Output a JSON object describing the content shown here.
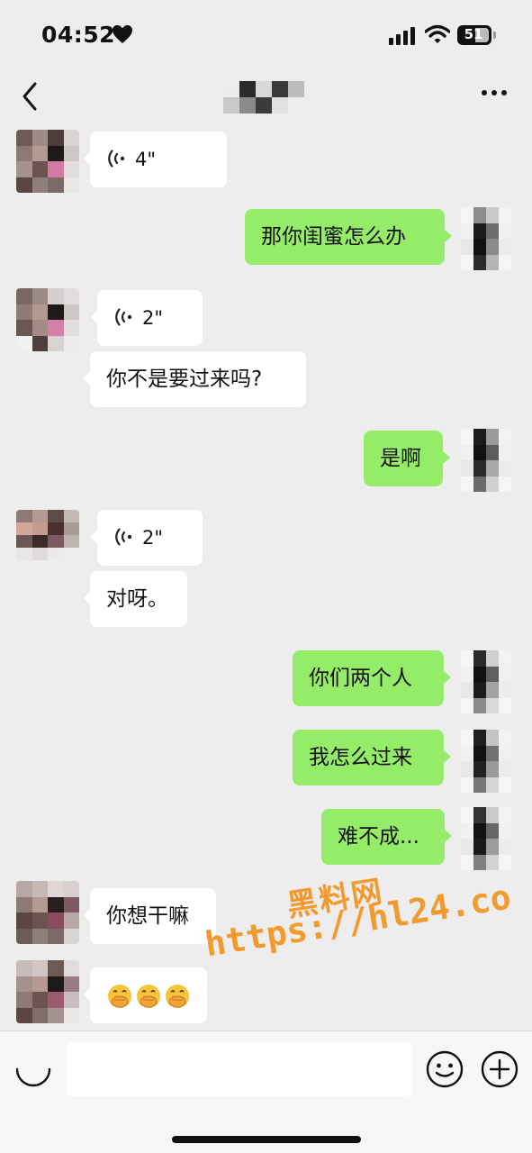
{
  "status": {
    "time": "04:52",
    "battery": "51"
  },
  "messages": [
    {
      "side": "in",
      "kind": "voice",
      "duration": "4\""
    },
    {
      "side": "out",
      "kind": "text",
      "text": "那你闺蜜怎么办"
    },
    {
      "side": "in",
      "kind": "voice",
      "duration": "2\""
    },
    {
      "side": "in",
      "kind": "text",
      "text": "你不是要过来吗?"
    },
    {
      "side": "out",
      "kind": "text",
      "text": "是啊"
    },
    {
      "side": "in",
      "kind": "voice",
      "duration": "2\""
    },
    {
      "side": "in",
      "kind": "text",
      "text": "对呀。"
    },
    {
      "side": "out",
      "kind": "text",
      "text": "你们两个人"
    },
    {
      "side": "out",
      "kind": "text",
      "text": "我怎么过来"
    },
    {
      "side": "out",
      "kind": "text",
      "text": "难不成..."
    },
    {
      "side": "in",
      "kind": "text",
      "text": "你想干嘛"
    },
    {
      "side": "in",
      "kind": "emoji",
      "emoji_name": "face-with-hand-over-mouth",
      "count": 3
    }
  ],
  "watermark": {
    "line1": "黑料网",
    "line2": "https://hl24.co"
  },
  "colors": {
    "background": "#ededed",
    "outgoing_bubble": "#95ec69",
    "incoming_bubble": "#ffffff",
    "watermark": "#f29a2e"
  },
  "icons": [
    "back-chevron-icon",
    "more-dots-icon",
    "voice-wave-icon",
    "voice-toggle-icon",
    "emoji-smile-icon",
    "plus-icon",
    "signal-icon",
    "wifi-icon",
    "heart-icon"
  ]
}
